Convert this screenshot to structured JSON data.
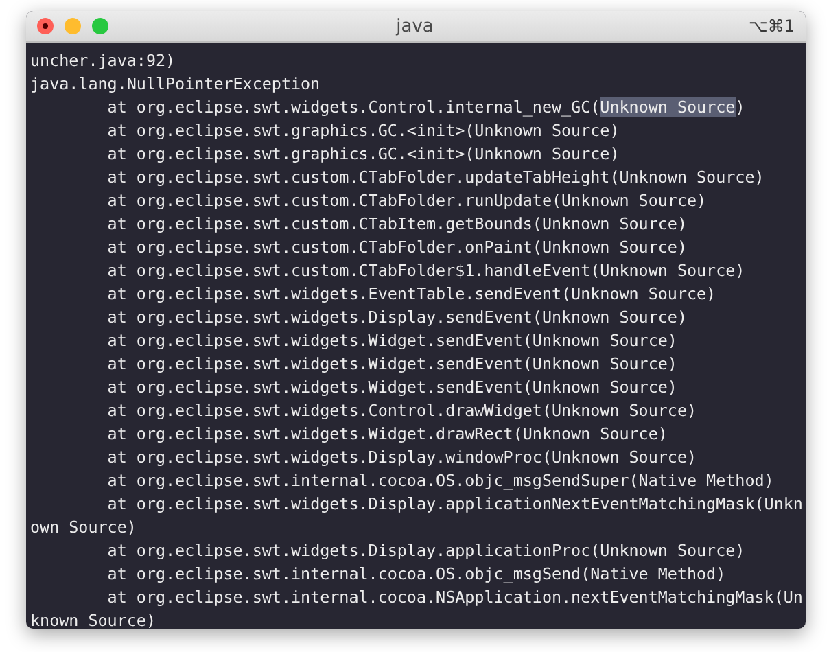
{
  "window": {
    "title": "java",
    "shortcut": "⌥⌘1",
    "buttons": [
      {
        "kind": "close"
      },
      {
        "kind": "minimize"
      },
      {
        "kind": "zoom"
      }
    ]
  },
  "lines": [
    {
      "indent": false,
      "segments": [
        {
          "text": "uncher.java:92)",
          "selected": false
        }
      ]
    },
    {
      "indent": false,
      "segments": [
        {
          "text": "java.lang.NullPointerException",
          "selected": false
        }
      ]
    },
    {
      "indent": true,
      "segments": [
        {
          "text": "at org.eclipse.swt.widgets.Control.internal_new_GC(",
          "selected": false
        },
        {
          "text": "Unknown Source",
          "selected": true
        },
        {
          "text": ")",
          "selected": false
        }
      ]
    },
    {
      "indent": true,
      "segments": [
        {
          "text": "at org.eclipse.swt.graphics.GC.<init>(Unknown Source)",
          "selected": false
        }
      ]
    },
    {
      "indent": true,
      "segments": [
        {
          "text": "at org.eclipse.swt.graphics.GC.<init>(Unknown Source)",
          "selected": false
        }
      ]
    },
    {
      "indent": true,
      "segments": [
        {
          "text": "at org.eclipse.swt.custom.CTabFolder.updateTabHeight(Unknown Source)",
          "selected": false
        }
      ]
    },
    {
      "indent": true,
      "segments": [
        {
          "text": "at org.eclipse.swt.custom.CTabFolder.runUpdate(Unknown Source)",
          "selected": false
        }
      ]
    },
    {
      "indent": true,
      "segments": [
        {
          "text": "at org.eclipse.swt.custom.CTabItem.getBounds(Unknown Source)",
          "selected": false
        }
      ]
    },
    {
      "indent": true,
      "segments": [
        {
          "text": "at org.eclipse.swt.custom.CTabFolder.onPaint(Unknown Source)",
          "selected": false
        }
      ]
    },
    {
      "indent": true,
      "segments": [
        {
          "text": "at org.eclipse.swt.custom.CTabFolder$1.handleEvent(Unknown Source)",
          "selected": false
        }
      ]
    },
    {
      "indent": true,
      "segments": [
        {
          "text": "at org.eclipse.swt.widgets.EventTable.sendEvent(Unknown Source)",
          "selected": false
        }
      ]
    },
    {
      "indent": true,
      "segments": [
        {
          "text": "at org.eclipse.swt.widgets.Display.sendEvent(Unknown Source)",
          "selected": false
        }
      ]
    },
    {
      "indent": true,
      "segments": [
        {
          "text": "at org.eclipse.swt.widgets.Widget.sendEvent(Unknown Source)",
          "selected": false
        }
      ]
    },
    {
      "indent": true,
      "segments": [
        {
          "text": "at org.eclipse.swt.widgets.Widget.sendEvent(Unknown Source)",
          "selected": false
        }
      ]
    },
    {
      "indent": true,
      "segments": [
        {
          "text": "at org.eclipse.swt.widgets.Widget.sendEvent(Unknown Source)",
          "selected": false
        }
      ]
    },
    {
      "indent": true,
      "segments": [
        {
          "text": "at org.eclipse.swt.widgets.Control.drawWidget(Unknown Source)",
          "selected": false
        }
      ]
    },
    {
      "indent": true,
      "segments": [
        {
          "text": "at org.eclipse.swt.widgets.Widget.drawRect(Unknown Source)",
          "selected": false
        }
      ]
    },
    {
      "indent": true,
      "segments": [
        {
          "text": "at org.eclipse.swt.widgets.Display.windowProc(Unknown Source)",
          "selected": false
        }
      ]
    },
    {
      "indent": true,
      "segments": [
        {
          "text": "at org.eclipse.swt.internal.cocoa.OS.objc_msgSendSuper(Native Method)",
          "selected": false
        }
      ]
    },
    {
      "indent": true,
      "segments": [
        {
          "text": "at org.eclipse.swt.widgets.Display.applicationNextEventMatchingMask(Unkn",
          "selected": false
        }
      ]
    },
    {
      "indent": false,
      "segments": [
        {
          "text": "own Source)",
          "selected": false
        }
      ]
    },
    {
      "indent": true,
      "segments": [
        {
          "text": "at org.eclipse.swt.widgets.Display.applicationProc(Unknown Source)",
          "selected": false
        }
      ]
    },
    {
      "indent": true,
      "segments": [
        {
          "text": "at org.eclipse.swt.internal.cocoa.OS.objc_msgSend(Native Method)",
          "selected": false
        }
      ]
    },
    {
      "indent": true,
      "segments": [
        {
          "text": "at org.eclipse.swt.internal.cocoa.NSApplication.nextEventMatchingMask(Un",
          "selected": false
        }
      ]
    },
    {
      "indent": false,
      "segments": [
        {
          "text": "known Source)",
          "selected": false
        }
      ]
    }
  ]
}
